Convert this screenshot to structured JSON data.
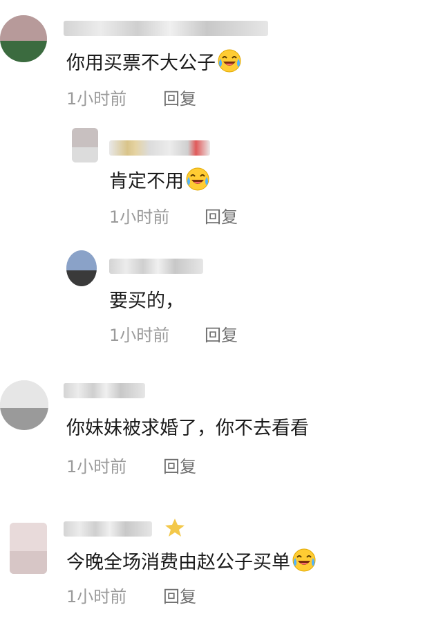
{
  "comments": [
    {
      "text": "你用买票不大公子",
      "emoji": "crying-laughing-emoji",
      "time": "1小时前",
      "reply": "回复"
    },
    {
      "text": "肯定不用",
      "emoji": "crying-laughing-emoji",
      "time": "1小时前",
      "reply": "回复"
    },
    {
      "text": "要买的，",
      "time": "1小时前",
      "reply": "回复"
    },
    {
      "text": "你妹妹被求婚了，你不去看看",
      "time": "1小时前",
      "reply": "回复"
    },
    {
      "text": "今晚全场消费由赵公子买单",
      "emoji": "crying-laughing-emoji",
      "time": "1小时前",
      "reply": "回复"
    }
  ]
}
